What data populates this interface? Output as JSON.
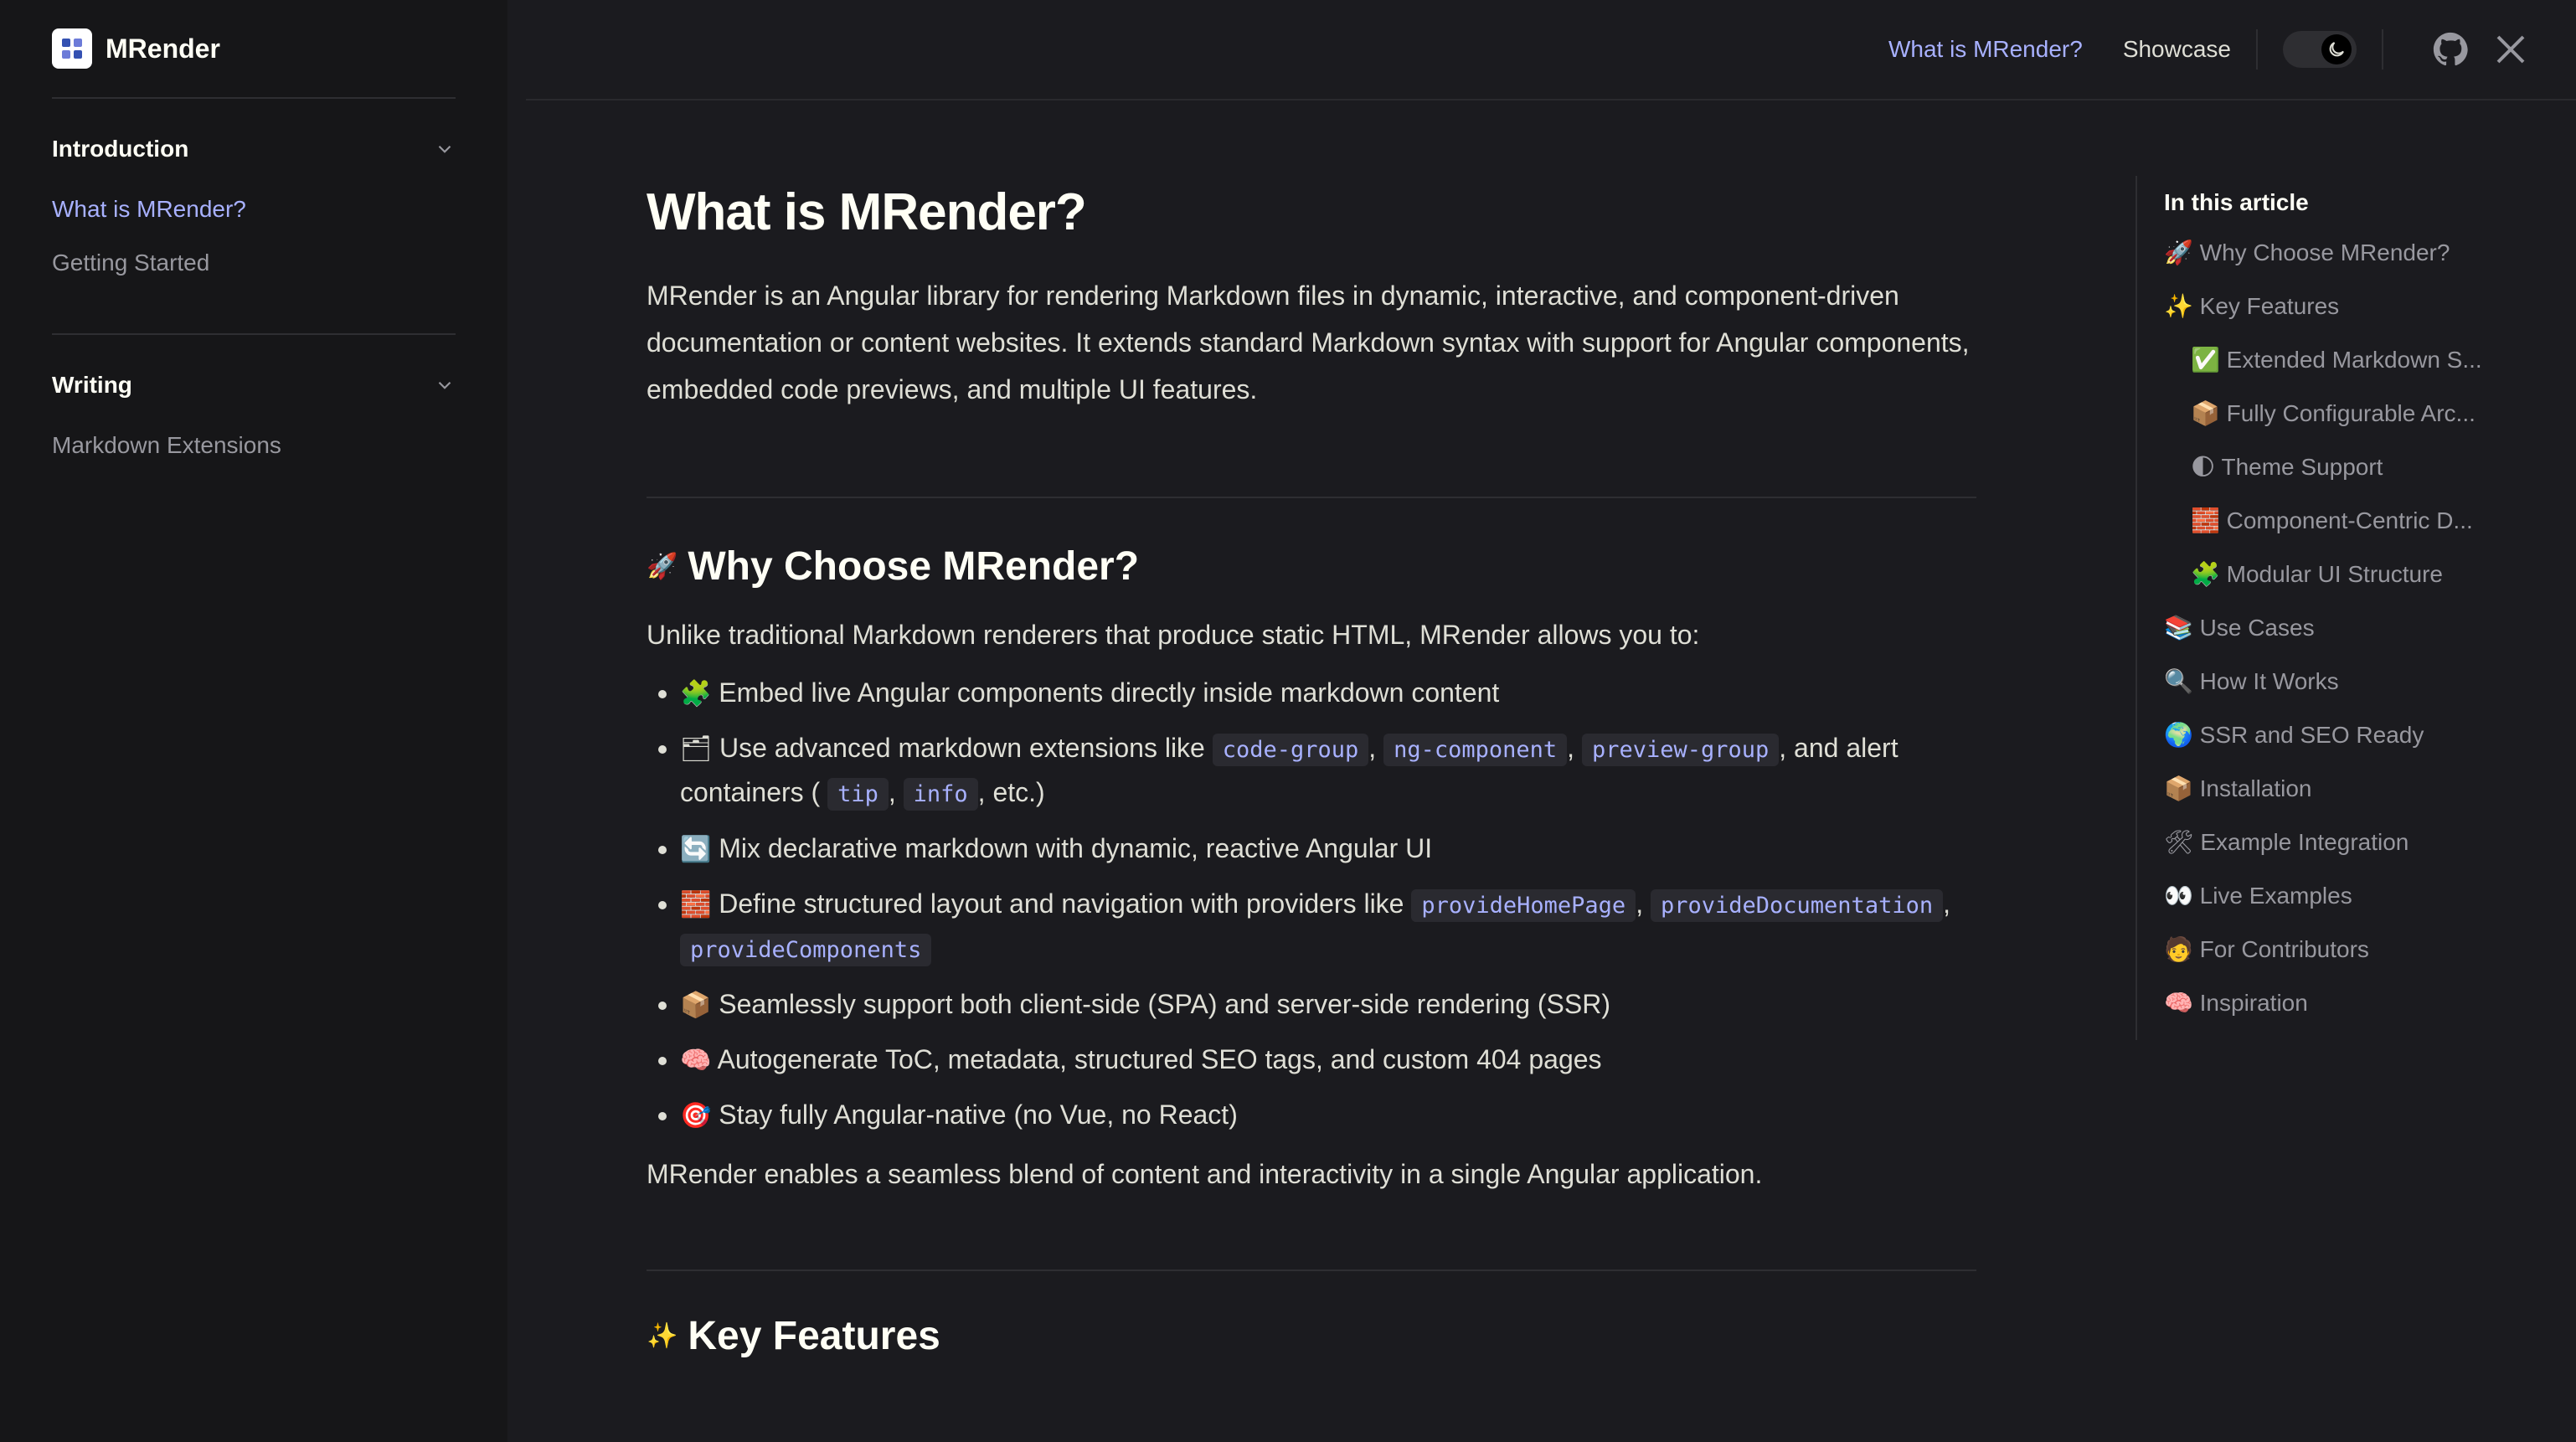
{
  "brand": {
    "name": "MRender",
    "logo_icon": "mrender-logo-icon"
  },
  "sidebar": {
    "groups": [
      {
        "title": "Introduction",
        "items": [
          {
            "label": "What is MRender?",
            "active": true
          },
          {
            "label": "Getting Started"
          }
        ]
      },
      {
        "title": "Writing",
        "items": [
          {
            "label": "Markdown Extensions"
          }
        ]
      }
    ]
  },
  "header": {
    "nav": [
      "What is MRender?",
      "Showcase"
    ],
    "icons": [
      "theme-toggle-icon",
      "github-icon",
      "x-icon"
    ]
  },
  "main": {
    "title": "What is MRender?",
    "lead": "MRender is an Angular library for rendering Markdown files in dynamic, interactive, and component-driven documentation or content websites. It extends standard Markdown syntax with support for Angular components, embedded code previews, and multiple UI features.",
    "sections": [
      {
        "emoji": "🚀",
        "heading": "Why Choose MRender?",
        "intro": "Unlike traditional Markdown renderers that produce static HTML, MRender allows you to:",
        "bullets": [
          {
            "emoji": "🧩",
            "text": "Embed live Angular components directly inside markdown content"
          },
          {
            "emoji": "🗂",
            "text_a": "Use advanced markdown extensions like",
            "code1": "code-group",
            "code2": "ng-component",
            "code3": "preview-group",
            "text_b": ", and alert containers (",
            "code4": "tip",
            "code5": "info",
            "text_c": ", etc.)"
          },
          {
            "emoji": "🔄",
            "text": "Mix declarative markdown with dynamic, reactive Angular UI"
          },
          {
            "emoji": "🧱",
            "text_a": "Define structured layout and navigation with providers like",
            "code1": "provideHomePage",
            "code2": "provideDocumentation",
            "code3": "provideComponents"
          },
          {
            "emoji": "📦",
            "text": "Seamlessly support both client-side (SPA) and server-side rendering (SSR)"
          },
          {
            "emoji": "🧠",
            "text": "Autogenerate ToC, metadata, structured SEO tags, and custom 404 pages"
          },
          {
            "emoji": "🎯",
            "text": "Stay fully Angular-native (no Vue, no React)"
          }
        ],
        "outro": "MRender enables a seamless blend of content and interactivity in a single Angular application."
      },
      {
        "emoji": "✨",
        "heading": "Key Features"
      }
    ]
  },
  "toc": {
    "title": "In this article",
    "items": [
      {
        "label": "🚀 Why Choose MRender?",
        "active": true
      },
      {
        "label": "✨ Key Features"
      },
      {
        "label": "✅ Extended Markdown S...",
        "sub": true
      },
      {
        "label": "📦 Fully Configurable Arc...",
        "sub": true
      },
      {
        "label": "🌓 Theme Support",
        "sub": true
      },
      {
        "label": "🧱 Component-Centric D...",
        "sub": true
      },
      {
        "label": "🧩 Modular UI Structure",
        "sub": true
      },
      {
        "label": "📚 Use Cases"
      },
      {
        "label": "🔍 How It Works"
      },
      {
        "label": "🌍 SSR and SEO Ready"
      },
      {
        "label": "📦 Installation"
      },
      {
        "label": "🛠 Example Integration"
      },
      {
        "label": "👀 Live Examples"
      },
      {
        "label": "🧑 For Contributors"
      },
      {
        "label": "🧠 Inspiration"
      }
    ]
  }
}
